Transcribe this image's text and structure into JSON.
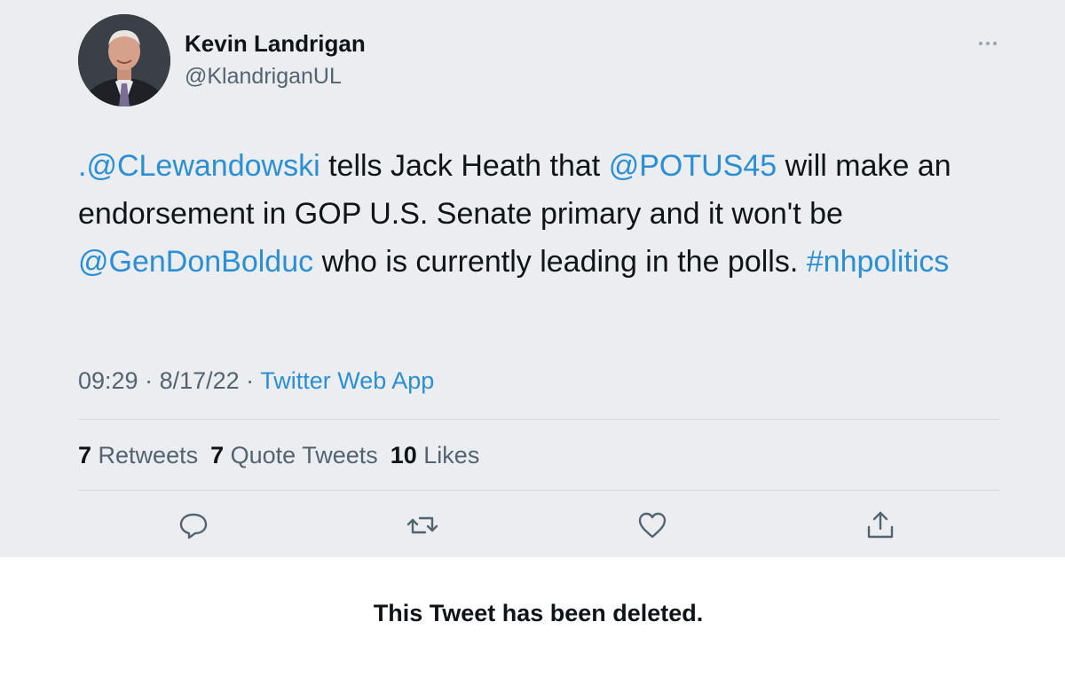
{
  "tweet": {
    "author": {
      "display_name": "Kevin Landrigan",
      "handle": "@KlandriganUL"
    },
    "text": {
      "mention_1": ".@CLewandowski",
      "part_1": " tells Jack Heath that ",
      "mention_2": "@POTUS45",
      "part_2": " will make an endorsement in GOP U.S. Senate primary and it won't be ",
      "mention_3": "@GenDonBolduc",
      "part_3": " who is currently leading in the polls. ",
      "hashtag": "#nhpolitics"
    },
    "meta": {
      "time": "09:29",
      "sep_1": " · ",
      "date": "8/17/22",
      "sep_2": " · ",
      "source": "Twitter Web App"
    },
    "stats": {
      "retweets_count": "7",
      "retweets_label": " Retweets",
      "quotes_count": "7",
      "quotes_label": " Quote Tweets",
      "likes_count": "10",
      "likes_label": " Likes"
    },
    "actions": [
      "reply-icon",
      "retweet-icon",
      "like-icon",
      "share-icon"
    ]
  },
  "notice": {
    "deleted": "This Tweet has been deleted."
  },
  "colors": {
    "card_background": "#ebedf0",
    "link": "#2b8fd6",
    "secondary_text": "#536471",
    "primary_text": "#0f1419"
  }
}
